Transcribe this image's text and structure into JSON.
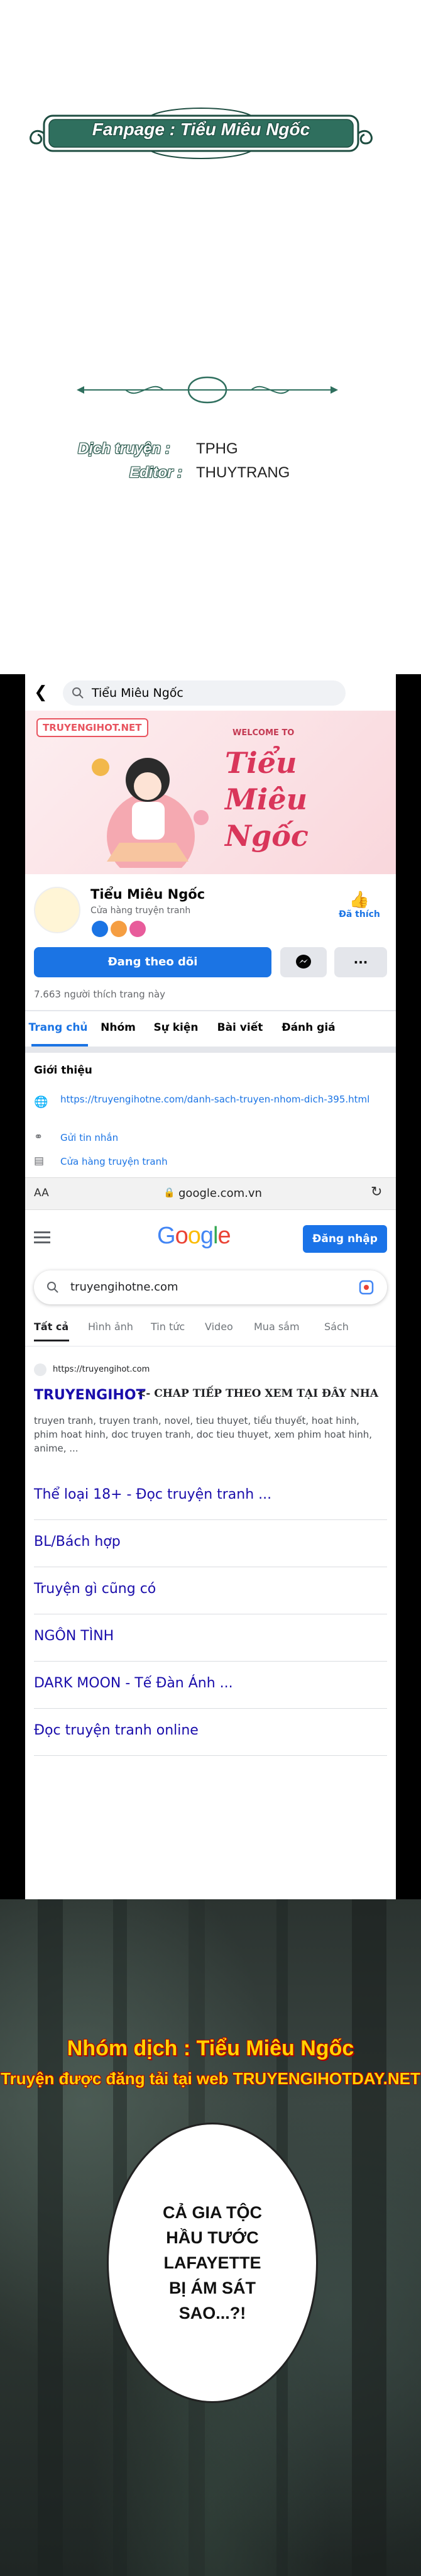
{
  "banner": {
    "fanpage": "Fanpage : Tiểu Miêu Ngốc"
  },
  "credits": {
    "translator_label": "Dịch truyện :",
    "translator_value": "TPHG",
    "editor_label": "Editor :",
    "editor_value": "THUYTRANG"
  },
  "fb": {
    "search_text": "Tiểu Miêu Ngốc",
    "cover_logo": "TRUYENGIHOT.NET",
    "cover_welcome": "WELCOME TO",
    "cover_title": "Tiểu Miêu Ngốc",
    "page_name": "Tiểu Miêu Ngốc",
    "page_category": "Cửa hàng truyện tranh",
    "liked_label": "Đã thích",
    "follow_button": "Đang theo dõi",
    "more_button": "···",
    "likes_count": "7.663 người thích trang này",
    "tabs": [
      "Trang chủ",
      "Nhóm",
      "Sự kiện",
      "Bài viết",
      "Đánh giá"
    ],
    "intro_title": "Giới thiệu",
    "intro_link": "https://truyengihotne.com/danh-sach-truyen-nhom-dich-395.html",
    "send_message": "Gửi tin nhắn",
    "store_label": "Cửa hàng truyện tranh"
  },
  "browser": {
    "aa": "AA",
    "url": "google.com.vn",
    "lock_icon": "lock-icon",
    "reload_icon": "reload-icon"
  },
  "google": {
    "logo": "Google",
    "signin": "Đăng nhập",
    "query": "truyengihotne.com",
    "tabs": [
      "Tất cả",
      "Hình ảnh",
      "Tin tức",
      "Video",
      "Mua sắm",
      "Sách"
    ],
    "result_url": "https://truyengihot.com",
    "result_title": "TRUYENGIHOT",
    "result_annotation": "<- CHAP TIẾP THEO XEM TẠI ĐÂY NHA",
    "result_snippet": "truyen tranh, truyen tranh, novel, tieu thuyet, tiểu thuyết, hoat hinh, phim hoat hinh, doc truyen tranh, doc tieu thuyet, xem phim hoat hinh, anime, ...",
    "links": [
      "Thể loại 18+ - Đọc truyện tranh ...",
      "BL/Bách hợp",
      "Truyện gì cũng có",
      "NGÔN TÌNH",
      "DARK MOON - Tế Đàn Ánh ...",
      "Đọc truyện tranh online"
    ]
  },
  "manga": {
    "team": "Nhóm dịch : Tiểu Miêu Ngốc",
    "note": "Truyện được đăng tải tại web TRUYENGIHOTDAY.NET",
    "speech": [
      "CẢ GIA TỘC",
      "HẦU TƯỚC",
      "LAFAYETTE",
      "BỊ ÁM SÁT",
      "SAO...?!"
    ]
  },
  "colors": {
    "fb_blue": "#1b74e4",
    "google_blue": "#1a0dab",
    "banner_green": "#1e4d41",
    "title_yellow": "#ffd400"
  }
}
